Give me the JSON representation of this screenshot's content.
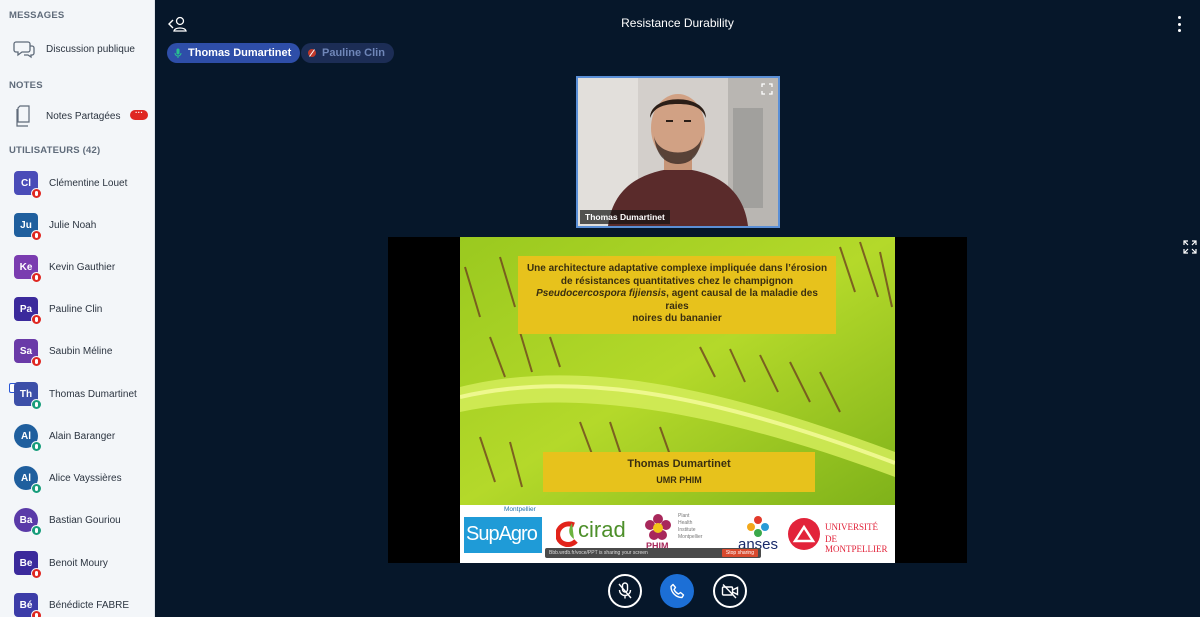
{
  "sidebar": {
    "messages_title": "MESSAGES",
    "public_chat": "Discussion publique",
    "notes_title": "NOTES",
    "shared_notes": "Notes Partagées",
    "notes_badge": "···",
    "users_title": "UTILISATEURS (42)",
    "users": [
      {
        "initials": "Cl",
        "name": "Clémentine Louet",
        "color": "#4a4cb8",
        "mic": "muted"
      },
      {
        "initials": "Ju",
        "name": "Julie Noah",
        "color": "#1f5f9e",
        "mic": "muted"
      },
      {
        "initials": "Ke",
        "name": "Kevin Gauthier",
        "color": "#7a3cb0",
        "mic": "muted"
      },
      {
        "initials": "Pa",
        "name": "Pauline Clin",
        "color": "#3b2a9c",
        "mic": "muted"
      },
      {
        "initials": "Sa",
        "name": "Saubin Méline",
        "color": "#6a3aa8",
        "mic": "muted"
      },
      {
        "initials": "Th",
        "name": "Thomas Dumartinet",
        "color": "#3c4fa8",
        "mic": "live"
      },
      {
        "initials": "Al",
        "name": "Alain Baranger",
        "color": "#1f5f9e",
        "mic": "live"
      },
      {
        "initials": "Al",
        "name": "Alice Vayssières",
        "color": "#1f5f9e",
        "mic": "live"
      },
      {
        "initials": "Ba",
        "name": "Bastian Gouriou",
        "color": "#5a3aa8",
        "mic": "live"
      },
      {
        "initials": "Be",
        "name": "Benoit Moury",
        "color": "#3b2a9c",
        "mic": "muted"
      },
      {
        "initials": "Bé",
        "name": "Bénédicte FABRE",
        "color": "#3c3ca8",
        "mic": "muted"
      }
    ]
  },
  "header": {
    "title": "Resistance Durability"
  },
  "talkers": [
    {
      "name": "Thomas Dumartinet",
      "active": true
    },
    {
      "name": "Pauline Clin",
      "active": false
    }
  ],
  "webcam": {
    "name": "Thomas Dumartinet"
  },
  "slide": {
    "title_line1": "Une architecture adaptative complexe impliquée dans l’érosion",
    "title_line2": "de résistances quantitatives chez le champignon",
    "title_italic": "Pseudocercospora fijiensis",
    "title_line3_rest": ", agent causal de la maladie des raies",
    "title_line4": "noires du bananier",
    "author": "Thomas Dumartinet",
    "affiliation": "UMR PHIM",
    "logos": {
      "supagro_top": "Montpellier",
      "supagro": "SupAgro",
      "cirad": "cirad",
      "phim": "PHIM",
      "phim_sub": "Plant\nHealth\nInstitute\nMontpellier",
      "anses": "anses",
      "um_line1": "UNIVERSITÉ",
      "um_line2": "DE MONTPELLIER"
    },
    "sharing_text": "Bbb.wrdb.fr/voce/PPT is sharing your screen",
    "sharing_stop": "Stop sharing"
  },
  "colors": {
    "background": "#06172a",
    "accent": "#1c6fd6",
    "slide_box": "#e7c21c",
    "muted": "#df2721",
    "live": "#179d7b"
  }
}
